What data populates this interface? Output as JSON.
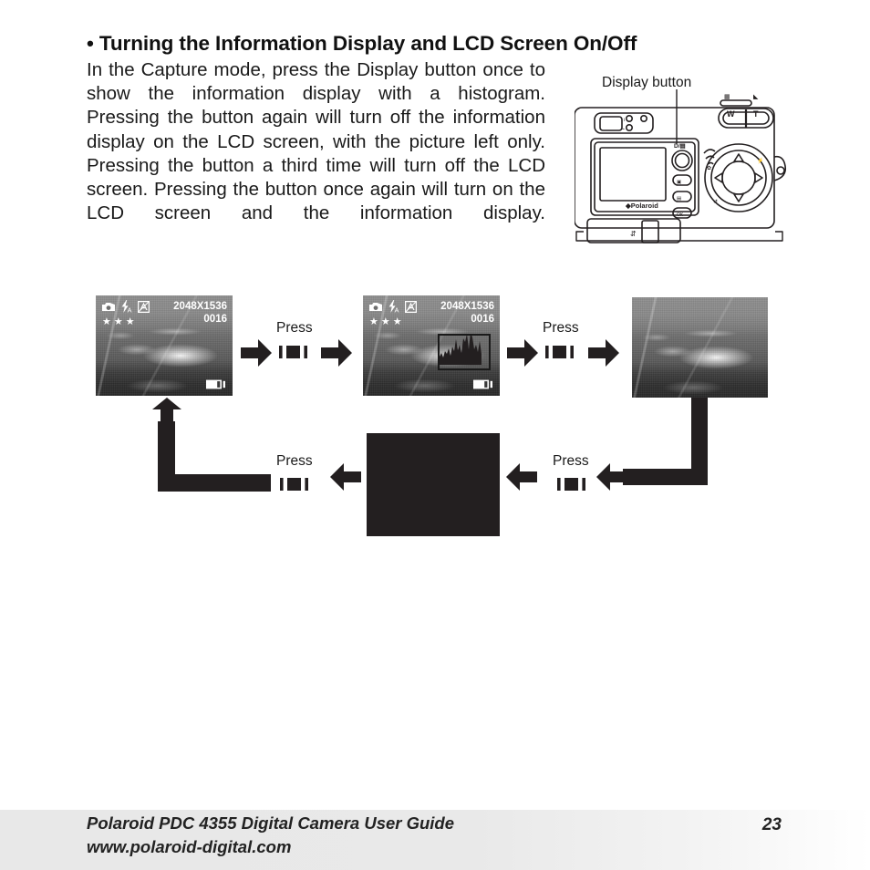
{
  "page": {
    "heading": "• Turning the Information Display and LCD Screen On/Off",
    "body": "In the Capture mode, press the Display button once to show the information display with a histogram. Pressing the button again will turn off the information display on the LCD screen, with the picture left only. Pressing the button a third time will turn off the LCD screen. Pressing the button once again will turn on the LCD screen and the information display."
  },
  "camera": {
    "callout_label": "Display button",
    "brand_label": "Polaroid",
    "zoom_wide_label": "W",
    "zoom_tele_label": "T",
    "display_button_label": "D/▤",
    "ok_button_label": "OK",
    "usb_label": "USB"
  },
  "flow": {
    "press_labels": [
      "Press",
      "Press",
      "Press",
      "Press"
    ],
    "screens": [
      {
        "id": "screen-info-display",
        "mode_icon": "camera-icon",
        "flash_icon": "flash-auto-icon",
        "quality_icon": "image-quality-icon",
        "stars": "★★★",
        "resolution": "2048X1536",
        "shots_remaining": "0016",
        "battery_icon": "battery-icon",
        "histogram": false
      },
      {
        "id": "screen-info-display-histogram",
        "mode_icon": "camera-icon",
        "flash_icon": "flash-auto-icon",
        "quality_icon": "image-quality-icon",
        "stars": "★★★",
        "resolution": "2048X1536",
        "shots_remaining": "0016",
        "battery_icon": "battery-icon",
        "histogram": true
      },
      {
        "id": "screen-picture-only",
        "histogram": false
      },
      {
        "id": "screen-lcd-off",
        "state": "LCD off"
      }
    ]
  },
  "footer": {
    "line1": "Polaroid PDC 4355 Digital Camera User Guide",
    "line2": "www.polaroid-digital.com",
    "page_number": "23"
  },
  "colors": {
    "ink": "#231f20",
    "text": "#1a1a1a",
    "footer_band": "#e8e8e8"
  }
}
